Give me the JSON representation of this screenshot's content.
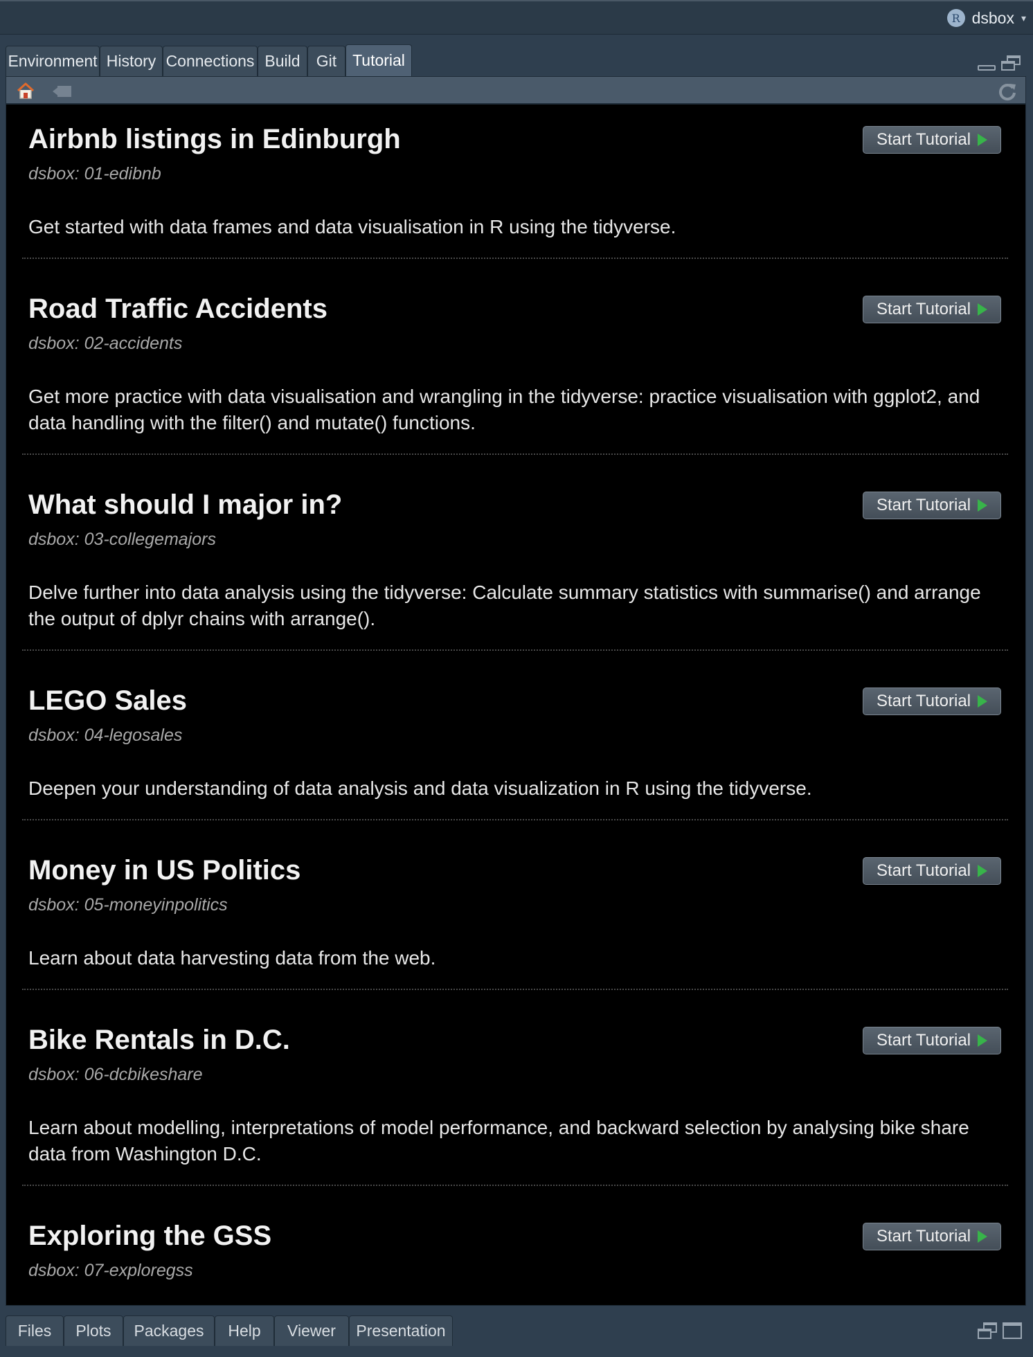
{
  "project": {
    "name": "dsbox",
    "badge": "R"
  },
  "top_pane": {
    "tabs": [
      "Environment",
      "History",
      "Connections",
      "Build",
      "Git",
      "Tutorial"
    ],
    "active_tab": "Tutorial"
  },
  "start_label": "Start Tutorial",
  "tutorials": [
    {
      "title": "Airbnb listings in Edinburgh",
      "pkg": "dsbox: 01-edibnb",
      "desc": "Get started with data frames and data visualisation in R using the tidyverse."
    },
    {
      "title": "Road Traffic Accidents",
      "pkg": "dsbox: 02-accidents",
      "desc": "Get more practice with data visualisation and wrangling in the tidyverse: practice visualisation with ggplot2, and data handling with the filter() and mutate() functions."
    },
    {
      "title": "What should I major in?",
      "pkg": "dsbox: 03-collegemajors",
      "desc": "Delve further into data analysis using the tidyverse: Calculate summary statistics with summarise() and arrange the output of dplyr chains with arrange()."
    },
    {
      "title": "LEGO Sales",
      "pkg": "dsbox: 04-legosales",
      "desc": "Deepen your understanding of data analysis and data visualization in R using the tidyverse."
    },
    {
      "title": "Money in US Politics",
      "pkg": "dsbox: 05-moneyinpolitics",
      "desc": "Learn about data harvesting data from the web."
    },
    {
      "title": "Bike Rentals in D.C.",
      "pkg": "dsbox: 06-dcbikeshare",
      "desc": "Learn about modelling, interpretations of model performance, and backward selection by analysing bike share data from Washington D.C."
    },
    {
      "title": "Exploring the GSS",
      "pkg": "dsbox: 07-exploregss",
      "desc": ""
    }
  ],
  "bottom_pane": {
    "tabs": [
      "Files",
      "Plots",
      "Packages",
      "Help",
      "Viewer",
      "Presentation"
    ]
  },
  "colors": {
    "accent_play": "#38b44a",
    "home_icon": "#e06a2c"
  }
}
